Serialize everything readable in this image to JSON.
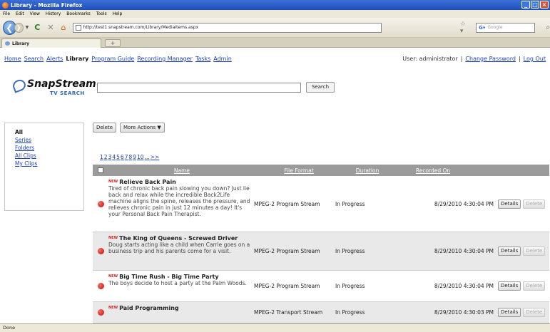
{
  "window": {
    "title": "Library - Mozilla Firefox"
  },
  "menu": [
    "File",
    "Edit",
    "View",
    "History",
    "Bookmarks",
    "Tools",
    "Help"
  ],
  "browser": {
    "url": "http://test1.snapstream.com/Library/MediaItems.aspx",
    "search_placeholder": "Google",
    "tab_title": "Library",
    "status": "Done"
  },
  "nav": {
    "links": [
      "Home",
      "Search",
      "Alerts"
    ],
    "active": "Library",
    "links2": [
      "Program Guide",
      "Recording Manager",
      "Tasks",
      "Admin"
    ]
  },
  "user": {
    "label": "User: administrator",
    "sep": "|",
    "change_password": "Change Password",
    "logout": "Log Out"
  },
  "logo": {
    "brand": "SnapStream",
    "sub": "TV SEARCH"
  },
  "search": {
    "button": "Search",
    "value": ""
  },
  "filters": {
    "all": "All",
    "items": [
      "Series",
      "Folders",
      "All Clips",
      "My Clips"
    ]
  },
  "toolbar": {
    "delete": "Delete",
    "more_actions": "More Actions ▼"
  },
  "pager": [
    "1",
    "2",
    "3",
    "4",
    "5",
    "6",
    "7",
    "8",
    "9",
    "10",
    "...",
    ">>"
  ],
  "table": {
    "headers": [
      "Name",
      "File Format",
      "Duration",
      "Recorded On"
    ],
    "new_tag": "NEW",
    "details_label": "Details",
    "delete_label": "Delete",
    "rows": [
      {
        "title": "Relieve Back Pain",
        "desc": "Tired of chronic back pain slowing you down? Just lie back and relax while the incredible Back2Life machine aligns the spine, releases the pressure, and relieves chronic pain in just 12 minutes a day! It's your Personal Back Pain Therapist.",
        "format": "MPEG-2 Program Stream",
        "duration": "In Progress",
        "recorded": "8/29/2010 4:30:04 PM"
      },
      {
        "title": "The King of Queens - Screwed Driver",
        "desc": "Doug starts acting like a child when Carrie goes on a business trip and his parents come for a visit.",
        "format": "MPEG-2 Program Stream",
        "duration": "In Progress",
        "recorded": "8/29/2010 4:30:04 PM"
      },
      {
        "title": "Big Time Rush - Big Time Party",
        "desc": "The boys decide to host a party at the Palm Woods.",
        "format": "MPEG-2 Program Stream",
        "duration": "In Progress",
        "recorded": "8/29/2010 4:30:04 PM"
      },
      {
        "title": "Paid Programming",
        "desc": "",
        "format": "MPEG-2 Transport Stream",
        "duration": "In Progress",
        "recorded": "8/29/2010 4:30:03 PM"
      }
    ]
  }
}
